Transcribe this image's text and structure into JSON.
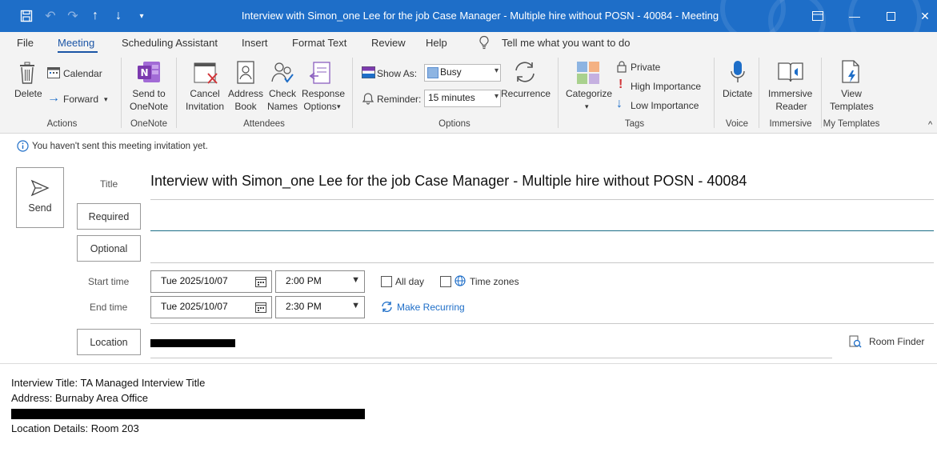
{
  "window": {
    "title": "Interview with Simon_one Lee for the job Case Manager - Multiple hire without POSN - 40084  -  Meeting"
  },
  "quick_access": [
    "save-icon",
    "undo-icon",
    "redo-icon",
    "up-arrow-icon",
    "down-arrow-icon",
    "customize-icon"
  ],
  "menu": {
    "tabs": [
      {
        "label": "File"
      },
      {
        "label": "Meeting",
        "active": true
      },
      {
        "label": "Scheduling Assistant"
      },
      {
        "label": "Insert"
      },
      {
        "label": "Format Text"
      },
      {
        "label": "Review"
      },
      {
        "label": "Help"
      }
    ],
    "tell_me": "Tell me what you want to do"
  },
  "ribbon": {
    "actions": {
      "delete": "Delete",
      "calendar": "Calendar",
      "forward": "Forward",
      "label": "Actions"
    },
    "onenote": {
      "line1": "Send to",
      "line2": "OneNote",
      "label": "OneNote"
    },
    "attendees": {
      "cancel": [
        "Cancel",
        "Invitation"
      ],
      "address": [
        "Address",
        "Book"
      ],
      "check": [
        "Check",
        "Names"
      ],
      "response": [
        "Response",
        "Options"
      ],
      "label": "Attendees"
    },
    "options": {
      "show_as_label": "Show As:",
      "show_as_value": "Busy",
      "reminder_label": "Reminder:",
      "reminder_value": "15 minutes",
      "recurrence": "Recurrence",
      "label": "Options"
    },
    "tags": {
      "categorize": "Categorize",
      "private": "Private",
      "high": "High Importance",
      "low": "Low Importance",
      "label": "Tags"
    },
    "voice": {
      "dictate": "Dictate",
      "label": "Voice"
    },
    "immersive": {
      "line1": "Immersive",
      "line2": "Reader",
      "label": "Immersive"
    },
    "templates": {
      "line1": "View",
      "line2": "Templates",
      "label": "My Templates"
    }
  },
  "form": {
    "info": "You haven't sent this meeting invitation yet.",
    "send": "Send",
    "title_label": "Title",
    "title_value": "Interview with Simon_one Lee for the job Case Manager - Multiple hire without POSN - 40084",
    "required": "Required",
    "optional": "Optional",
    "start_label": "Start time",
    "start_date": "Tue 2025/10/07",
    "start_time": "2:00 PM",
    "end_label": "End time",
    "end_date": "Tue 2025/10/07",
    "end_time": "2:30 PM",
    "all_day": "All day",
    "time_zones": "Time zones",
    "make_recurring": "Make Recurring",
    "location_btn": "Location",
    "room_finder": "Room Finder"
  },
  "body": {
    "lines": [
      "Interview Title: TA Managed Interview Title",
      "Address: Burnaby Area Office",
      "",
      "Location Details: Room 203"
    ]
  },
  "colors": {
    "titlebar": "#1e6ec8",
    "accent": "#1b55a6",
    "ribbon_bg": "#f3f3f3"
  }
}
